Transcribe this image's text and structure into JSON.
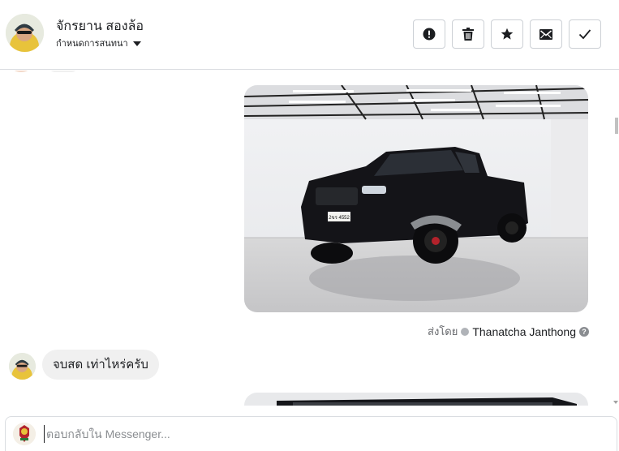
{
  "header": {
    "contact_name": "จักรยาน สองล้อ",
    "conversation_settings": "กำหนดการสนทนา",
    "actions": [
      {
        "name": "report-button",
        "icon": "exclamation-icon"
      },
      {
        "name": "delete-button",
        "icon": "trash-icon"
      },
      {
        "name": "star-button",
        "icon": "star-icon"
      },
      {
        "name": "mark-unread-button",
        "icon": "envelope-icon"
      },
      {
        "name": "done-button",
        "icon": "check-icon"
      }
    ]
  },
  "thread": {
    "sent_by_label": "ส่งโดย",
    "sent_by_name": "Thanatcha Janthong",
    "incoming_message": "จบสด เท่าไหร่ครับ",
    "photo_plate_text": "2ขร 4552"
  },
  "composer": {
    "placeholder": "ตอบกลับใน Messenger..."
  },
  "colors": {
    "border": "#dadde1",
    "bubble": "#f0f0f0",
    "muted_text": "#65676b"
  }
}
